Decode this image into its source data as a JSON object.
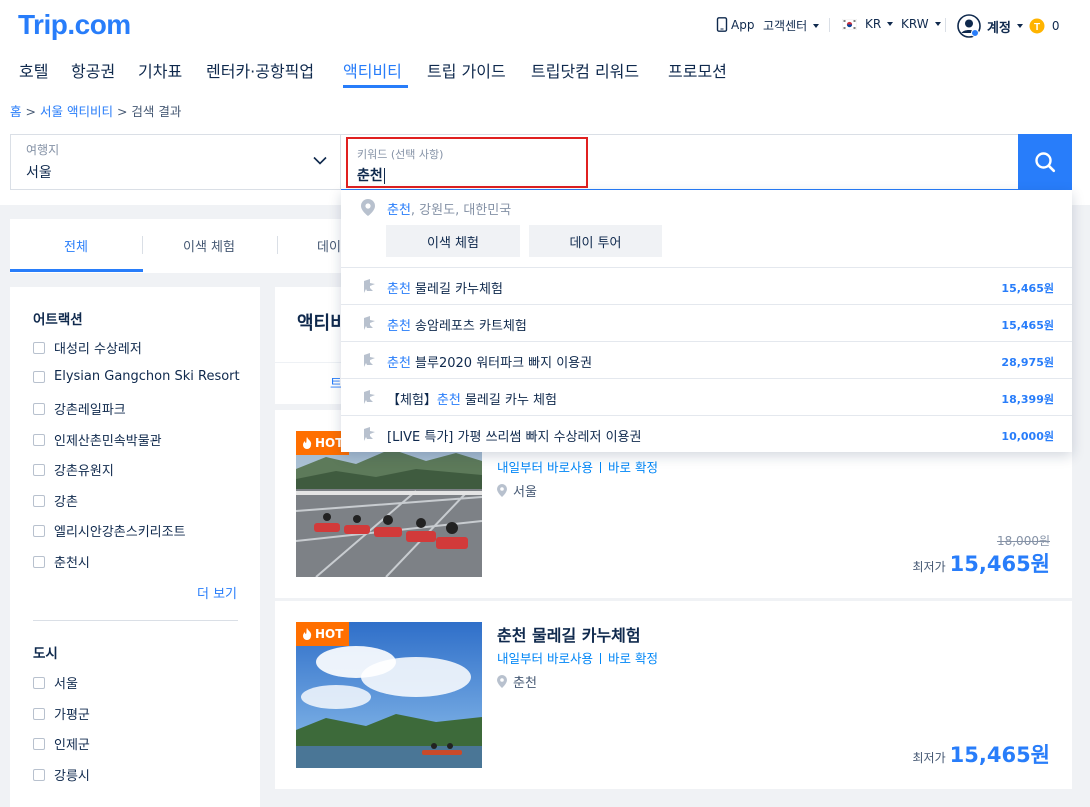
{
  "brand": {
    "logo": "Trip.com"
  },
  "utility": {
    "app": "App",
    "customer_center": "고객센터",
    "region": "KR",
    "currency": "KRW",
    "account": "계정",
    "points": "0"
  },
  "nav": {
    "items": [
      "호텔",
      "항공권",
      "기차표",
      "렌터카·공항픽업",
      "액티비티",
      "트립 가이드",
      "트립닷컴 리워드",
      "프로모션"
    ],
    "active": "액티비티"
  },
  "breadcrumb": {
    "home": "홈",
    "sep1": ">",
    "city": "서울 액티비티",
    "sep2": ">",
    "current": "검색 결과"
  },
  "search": {
    "destination_label": "여행지",
    "destination_value": "서울",
    "keyword_label": "키워드 (선택 사항)",
    "keyword_value": "춘천"
  },
  "tabs": {
    "items": [
      "전체",
      "이색 체험",
      "데이"
    ],
    "active": "전체"
  },
  "dropdown": {
    "location": {
      "highlight": "춘천",
      "rest": ", 강원도, 대한민국"
    },
    "chips": [
      "이색 체험",
      "데이 투어"
    ],
    "suggestions": [
      {
        "prefix": "",
        "highlight": "춘천",
        "rest": " 물레길 카누체험",
        "price": "15,465원"
      },
      {
        "prefix": "",
        "highlight": "춘천",
        "rest": " 송암레포츠 카트체험",
        "price": "15,465원"
      },
      {
        "prefix": "",
        "highlight": "춘천",
        "rest": " 블루2020 워터파크 빠지 이용권",
        "price": "28,975원"
      },
      {
        "prefix": "【체험】",
        "highlight": "춘천",
        "rest": " 물레길 카누 체험",
        "price": "18,399원"
      },
      {
        "prefix": "[LIVE 특가] 가평 쓰리썸 빠지 수상레저 이용권",
        "highlight": "",
        "rest": "",
        "price": "10,000원"
      }
    ]
  },
  "sidebar": {
    "attractions_title": "어트랙션",
    "attractions": [
      "대성리 수상레저",
      "Elysian Gangchon Ski Resort ...",
      "강촌레일파크",
      "인제산촌민속박물관",
      "강촌유원지",
      "강촌",
      "엘리시안강촌스키리조트",
      "춘천시"
    ],
    "more": "더 보기",
    "city_title": "도시",
    "cities": [
      "서울",
      "가평군",
      "인제군",
      "강릉시"
    ]
  },
  "main": {
    "title": "액티비",
    "subbar_label": "트",
    "cards": [
      {
        "badge": "HOT",
        "tag1": "내일부터 바로사용",
        "tag2": "바로 확정",
        "location": "서울",
        "original_price": "18,000원",
        "price_label": "최저가",
        "price": "15,465원"
      },
      {
        "badge": "HOT",
        "title": "춘천 물레길 카누체험",
        "tag1": "내일부터 바로사용",
        "tag2": "바로 확정",
        "location": "춘천",
        "price_label": "최저가",
        "price": "15,465원"
      }
    ]
  },
  "colors": {
    "accent": "#287dfa",
    "hot": "#ff6f00",
    "focus_outline": "#e02020",
    "text": "#0f294d"
  }
}
